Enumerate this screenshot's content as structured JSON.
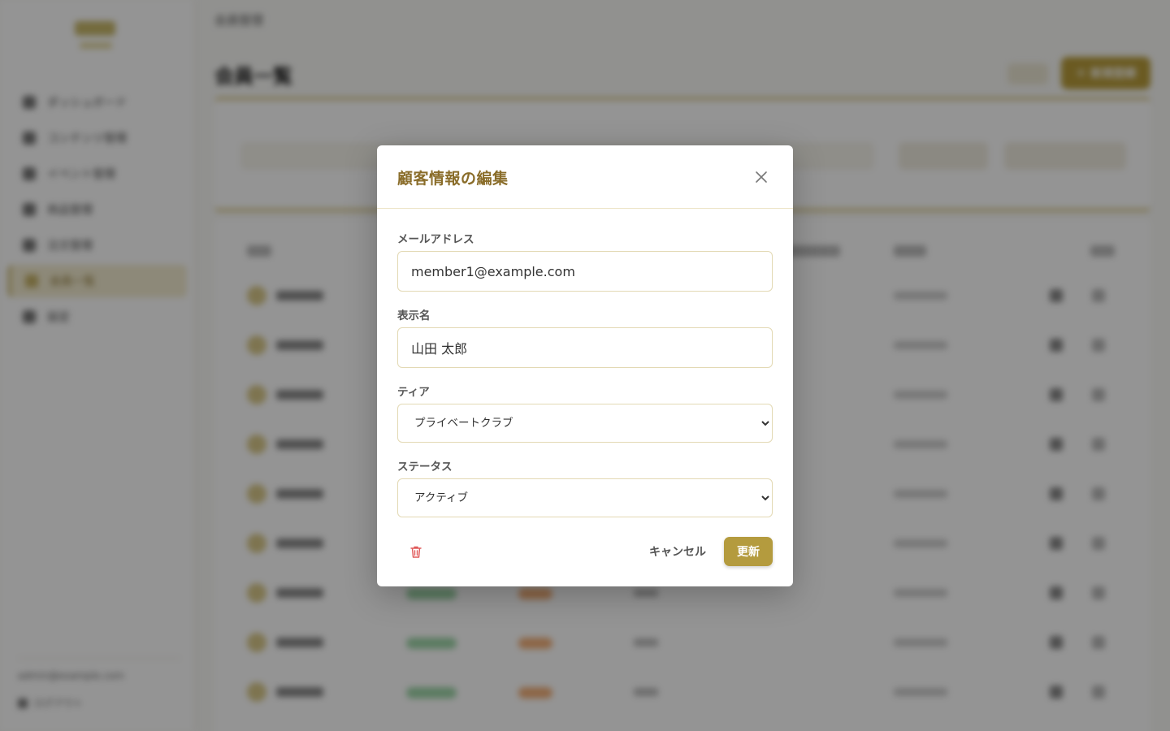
{
  "background": {
    "breadcrumb": "会員管理",
    "page_title": "会員一覧",
    "new_button": "＋ 新規登録",
    "nav_items": [
      "ダッシュボード",
      "コンテンツ管理",
      "イベント管理",
      "商品管理",
      "注文管理",
      "会員一覧",
      "設定"
    ],
    "active_nav": "会員一覧",
    "user_email": "admin@example.com",
    "logout_label": "ログアウト"
  },
  "modal": {
    "title": "顧客情報の編集",
    "email_label": "メールアドレス",
    "email_value": "member1@example.com",
    "name_label": "表示名",
    "name_value": "山田 太郎",
    "tier_label": "ティア",
    "tier_value": "プライベートクラブ",
    "status_label": "ステータス",
    "status_value": "アクティブ",
    "cancel_label": "キャンセル",
    "update_label": "更新"
  },
  "colors": {
    "accent": "#b49b3e",
    "title": "#8a6d2a",
    "danger": "#e05a5a",
    "overlay": "rgba(0,0,0,0.42)"
  }
}
